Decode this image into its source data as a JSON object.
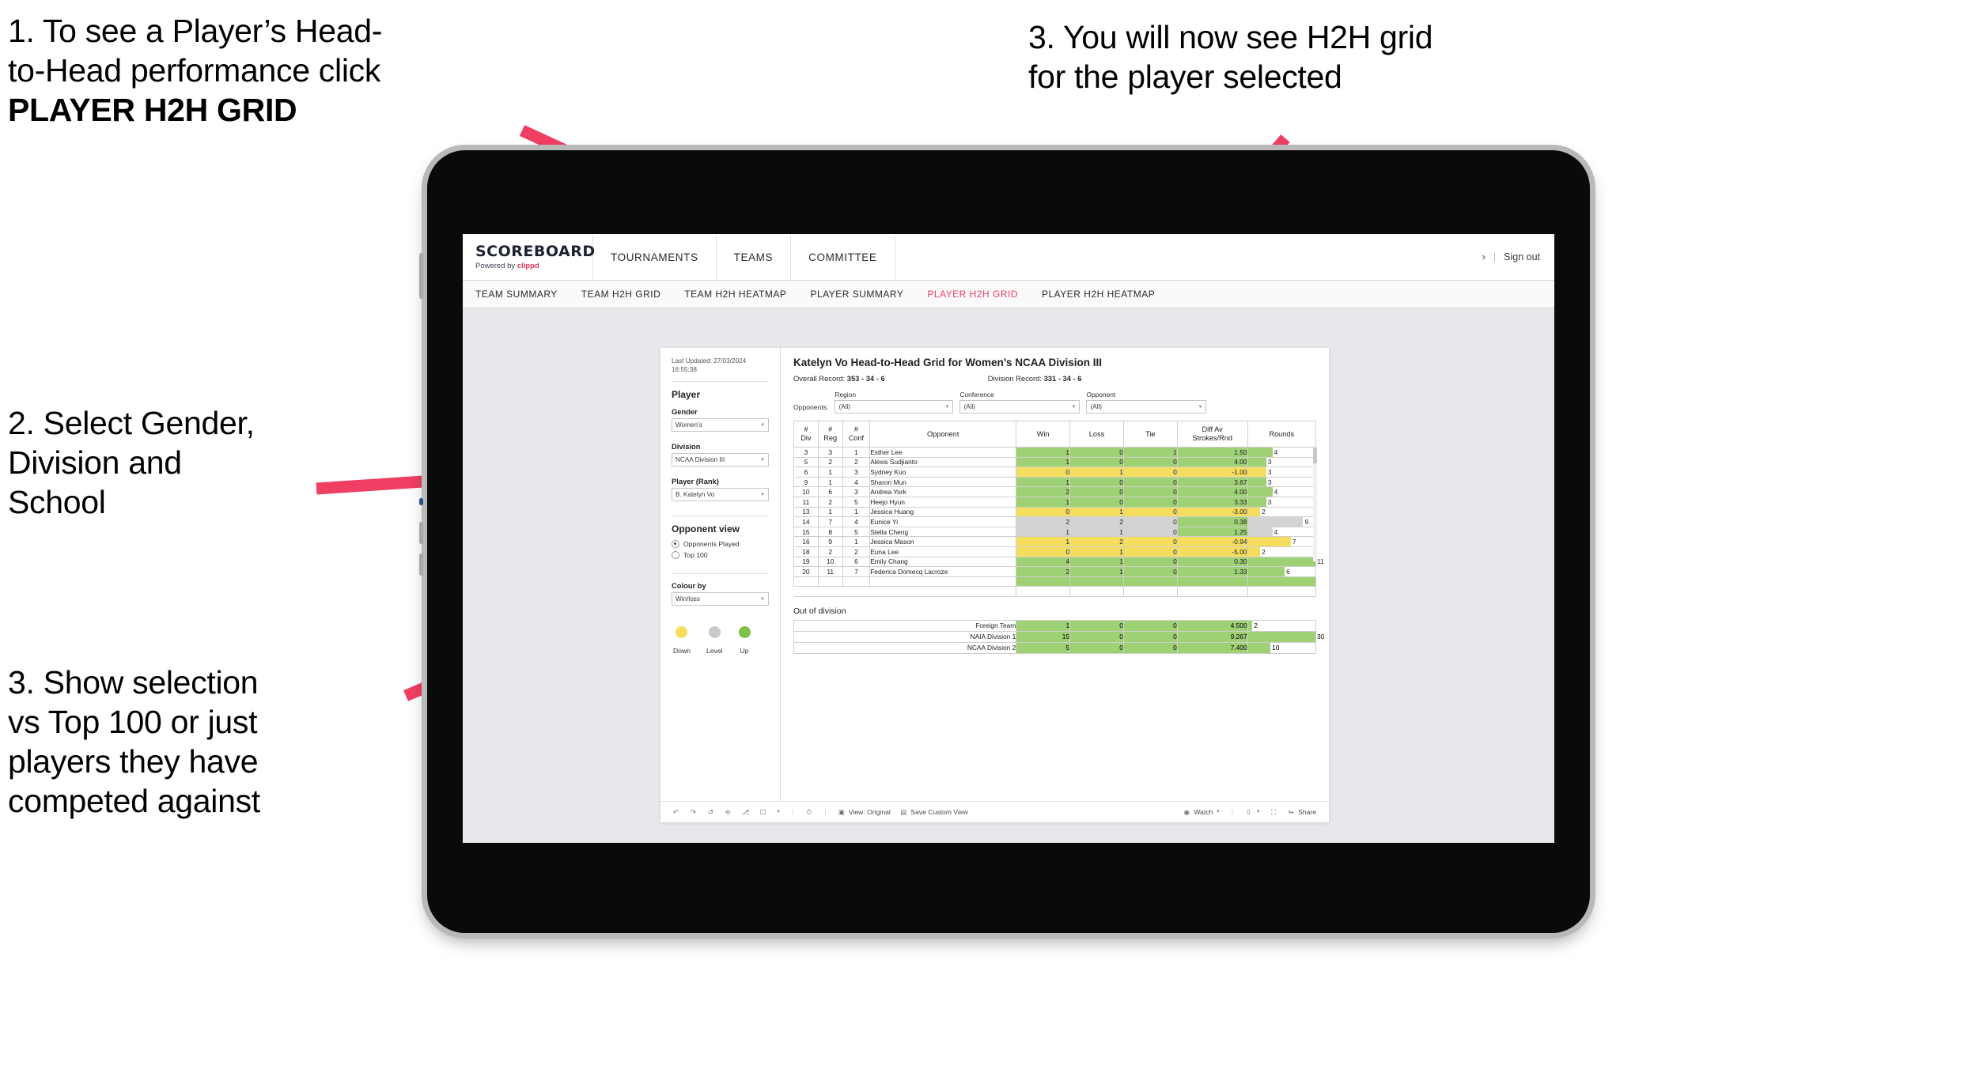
{
  "annotations": [
    {
      "id": "a1",
      "line1": "1. To see a Player’s Head-",
      "line2": "to-Head performance click",
      "line3": "PLAYER H2H GRID"
    },
    {
      "id": "a2",
      "line1": "2. Select Gender,",
      "line2": "Division and",
      "line3": "School"
    },
    {
      "id": "a3",
      "line1": "3. Show selection",
      "line2": "vs Top 100 or just",
      "line3": "players they have",
      "line4": "competed against"
    },
    {
      "id": "a4",
      "line1": "3. You will now see H2H grid",
      "line2": "for the player selected"
    }
  ],
  "colors": {
    "accent": "#ee3d63",
    "arrow": "#ef3f63",
    "up_green": "#9ed173",
    "down_yellow": "#f5de5e",
    "level_grey": "#d3d3d3"
  },
  "app": {
    "brand_name": "SCOREBOARD",
    "brand_sub_prefix": "Powered by ",
    "brand_sub_accent": "clippd",
    "nav": [
      {
        "label": "TOURNAMENTS"
      },
      {
        "label": "TEAMS"
      },
      {
        "label": "COMMITTEE"
      }
    ],
    "user_chevron": "›",
    "separator": "|",
    "sign_out": "Sign out",
    "tabs": [
      {
        "label": "TEAM SUMMARY",
        "active": false
      },
      {
        "label": "TEAM H2H GRID",
        "active": false
      },
      {
        "label": "TEAM H2H HEATMAP",
        "active": false
      },
      {
        "label": "PLAYER SUMMARY",
        "active": false
      },
      {
        "label": "PLAYER H2H GRID",
        "active": true
      },
      {
        "label": "PLAYER H2H HEATMAP",
        "active": false
      }
    ]
  },
  "panel": {
    "last_updated_line1": "Last Updated: 27/03/2024",
    "last_updated_line2": "16:55:38",
    "section_player": "Player",
    "gender_label": "Gender",
    "gender_value": "Women’s",
    "division_label": "Division",
    "division_value": "NCAA Division III",
    "player_label": "Player (Rank)",
    "player_value": "B. Katelyn Vo",
    "section_opponent_view": "Opponent view",
    "radio_opponents_played": "Opponents Played",
    "radio_top100": "Top 100",
    "colour_by_label": "Colour by",
    "colour_by_value": "Win/loss",
    "legend": [
      {
        "label": "Down",
        "color": "#f5de5e"
      },
      {
        "label": "Level",
        "color": "#c9c9c9"
      },
      {
        "label": "Up",
        "color": "#7ec04a"
      }
    ]
  },
  "viz": {
    "title": "Katelyn Vo Head-to-Head Grid for Women’s NCAA Division III",
    "overall_record_label": "Overall Record:",
    "overall_record_value": "353 - 34 - 6",
    "division_record_label": "Division Record:",
    "division_record_value": "331 - 34 - 6",
    "opponents_label": "Opponents:",
    "filters": [
      {
        "label": "Region",
        "value": "(All)"
      },
      {
        "label": "Conference",
        "value": "(All)"
      },
      {
        "label": "Opponent",
        "value": "(All)"
      }
    ],
    "columns": [
      "# Div",
      "# Reg",
      "# Conf",
      "Opponent",
      "Win",
      "Loss",
      "Tie",
      "Diff Av Strokes/Rnd",
      "Rounds"
    ],
    "column_lines": [
      [
        "#",
        "Div"
      ],
      [
        "#",
        "Reg"
      ],
      [
        "#",
        "Conf"
      ],
      [
        "Opponent"
      ],
      [
        "Win"
      ],
      [
        "Loss"
      ],
      [
        "Tie"
      ],
      [
        "Diff Av",
        "Strokes/Rnd"
      ],
      [
        "Rounds"
      ]
    ],
    "out_of_division_title": "Out of division"
  },
  "chart_data": {
    "type": "table",
    "title": "Katelyn Vo Head-to-Head Grid for Women’s NCAA Division III",
    "columns": [
      "# Div",
      "# Reg",
      "# Conf",
      "Opponent",
      "Win",
      "Loss",
      "Tie",
      "Diff Av Strokes/Rnd",
      "Rounds"
    ],
    "rows": [
      {
        "div": "3",
        "reg": "3",
        "conf": "1",
        "opponent": "Esther Lee",
        "win": "1",
        "loss": "0",
        "tie": "1",
        "diff": "1.50",
        "rounds": "4",
        "status": "up",
        "rounds_max": 11
      },
      {
        "div": "5",
        "reg": "2",
        "conf": "2",
        "opponent": "Alexis Sudjianto",
        "win": "1",
        "loss": "0",
        "tie": "0",
        "diff": "4.00",
        "rounds": "3",
        "status": "up",
        "rounds_max": 11
      },
      {
        "div": "6",
        "reg": "1",
        "conf": "3",
        "opponent": "Sydney Kuo",
        "win": "0",
        "loss": "1",
        "tie": "0",
        "diff": "-1.00",
        "rounds": "3",
        "status": "down",
        "rounds_max": 11
      },
      {
        "div": "9",
        "reg": "1",
        "conf": "4",
        "opponent": "Sharon Mun",
        "win": "1",
        "loss": "0",
        "tie": "0",
        "diff": "3.67",
        "rounds": "3",
        "status": "up",
        "rounds_max": 11
      },
      {
        "div": "10",
        "reg": "6",
        "conf": "3",
        "opponent": "Andrea York",
        "win": "2",
        "loss": "0",
        "tie": "0",
        "diff": "4.00",
        "rounds": "4",
        "status": "up",
        "rounds_max": 11
      },
      {
        "div": "11",
        "reg": "2",
        "conf": "5",
        "opponent": "Heejo Hyun",
        "win": "1",
        "loss": "0",
        "tie": "0",
        "diff": "3.33",
        "rounds": "3",
        "status": "up",
        "rounds_max": 11
      },
      {
        "div": "13",
        "reg": "1",
        "conf": "1",
        "opponent": "Jessica Huang",
        "win": "0",
        "loss": "1",
        "tie": "0",
        "diff": "-3.00",
        "rounds": "2",
        "status": "down",
        "rounds_max": 11
      },
      {
        "div": "14",
        "reg": "7",
        "conf": "4",
        "opponent": "Eunice Yi",
        "win": "2",
        "loss": "2",
        "tie": "0",
        "diff": "0.38",
        "rounds": "9",
        "status": "level",
        "rounds_max": 11
      },
      {
        "div": "15",
        "reg": "8",
        "conf": "5",
        "opponent": "Stella Cheng",
        "win": "1",
        "loss": "1",
        "tie": "0",
        "diff": "1.25",
        "rounds": "4",
        "status": "level",
        "rounds_max": 11
      },
      {
        "div": "16",
        "reg": "9",
        "conf": "1",
        "opponent": "Jessica Mason",
        "win": "1",
        "loss": "2",
        "tie": "0",
        "diff": "-0.94",
        "rounds": "7",
        "status": "down",
        "rounds_max": 11
      },
      {
        "div": "18",
        "reg": "2",
        "conf": "2",
        "opponent": "Euna Lee",
        "win": "0",
        "loss": "1",
        "tie": "0",
        "diff": "-5.00",
        "rounds": "2",
        "status": "down",
        "rounds_max": 11
      },
      {
        "div": "19",
        "reg": "10",
        "conf": "6",
        "opponent": "Emily Chang",
        "win": "4",
        "loss": "1",
        "tie": "0",
        "diff": "0.30",
        "rounds": "11",
        "status": "up",
        "rounds_max": 11
      },
      {
        "div": "20",
        "reg": "11",
        "conf": "7",
        "opponent": "Federica Domecq Lacroze",
        "win": "2",
        "loss": "1",
        "tie": "0",
        "diff": "1.33",
        "rounds": "6",
        "status": "up",
        "rounds_max": 11
      }
    ],
    "out_of_division": [
      {
        "name": "Foreign Team",
        "win": "1",
        "loss": "0",
        "tie": "0",
        "diff": "4.500",
        "rounds": "2",
        "status": "up",
        "rounds_max": 30
      },
      {
        "name": "NAIA Division 1",
        "win": "15",
        "loss": "0",
        "tie": "0",
        "diff": "9.267",
        "rounds": "30",
        "status": "up",
        "rounds_max": 30
      },
      {
        "name": "NCAA Division 2",
        "win": "5",
        "loss": "0",
        "tie": "0",
        "diff": "7.400",
        "rounds": "10",
        "status": "up",
        "rounds_max": 30
      }
    ]
  },
  "toolbar": {
    "view_original": "View: Original",
    "save_custom_view": "Save Custom View",
    "watch": "Watch",
    "share": "Share"
  }
}
